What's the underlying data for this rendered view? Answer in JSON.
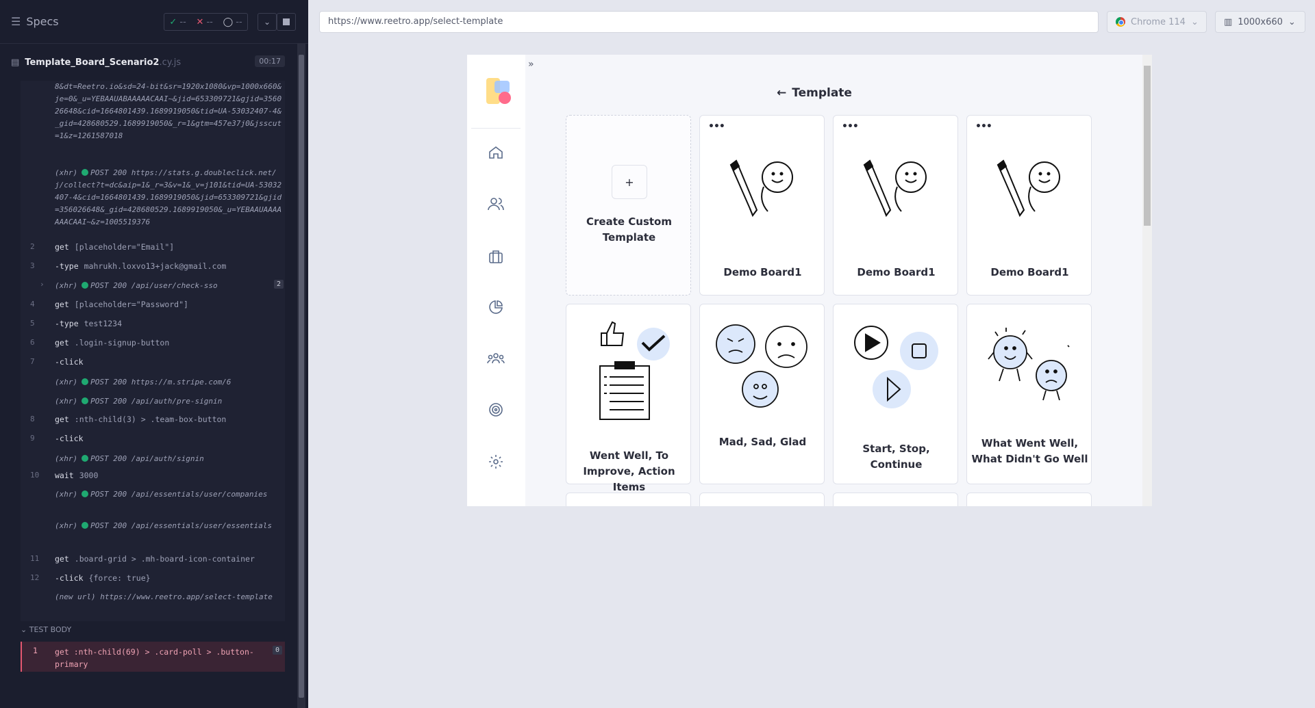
{
  "reporter": {
    "title": "Specs",
    "stats": {
      "passed": "--",
      "failed": "--",
      "pending": "--"
    },
    "spec_file": "Template_Board_Scenario2",
    "spec_ext": ".cy.js",
    "duration": "00:17",
    "log_top_text": "8&dt=Reetro.io&sd=24-bit&sr=1920x1080&vp=1000x660&je=0&_u=YEBAAUABAAAAACAAI~&jid=653309721&gjid=356026648&cid=1664801439.1689919050&tid=UA-53032407-4&_gid=428680529.1689919050&_r=1&gtm=457e37j0&jsscut=1&z=1261587018",
    "entries": [
      {
        "type": "xhr",
        "label": "(xhr)",
        "status": "POST 200",
        "url": "https://stats.g.doubleclick.net/j/collect?t=dc&aip=1&_r=3&v=1&_v=j101&tid=UA-53032407-4&cid=1664801439.1689919050&jid=653309721&gjid=356026648&_gid=428680529.1689919050&_u=YEBAAUAAAAAAACAAI~&z=1005519376"
      },
      {
        "type": "cmd",
        "num": "2",
        "name": "get",
        "arg": "[placeholder=\"Email\"]"
      },
      {
        "type": "cmd",
        "num": "3",
        "name": "-type",
        "arg": "mahrukh.loxvo13+jack@gmail.com"
      },
      {
        "type": "xhr",
        "label": "(xhr)",
        "status": "POST 200",
        "url": "/api/user/check-sso",
        "badge": "2"
      },
      {
        "type": "cmd",
        "num": "4",
        "name": "get",
        "arg": "[placeholder=\"Password\"]"
      },
      {
        "type": "cmd",
        "num": "5",
        "name": "-type",
        "arg": "test1234"
      },
      {
        "type": "cmd",
        "num": "6",
        "name": "get",
        "arg": ".login-signup-button"
      },
      {
        "type": "cmd",
        "num": "7",
        "name": "-click",
        "arg": ""
      },
      {
        "type": "xhr",
        "label": "(xhr)",
        "status": "POST 200",
        "url": "https://m.stripe.com/6"
      },
      {
        "type": "xhr",
        "label": "(xhr)",
        "status": "POST 200",
        "url": "/api/auth/pre-signin"
      },
      {
        "type": "cmd",
        "num": "8",
        "name": "get",
        "arg": ":nth-child(3) > .team-box-button"
      },
      {
        "type": "cmd",
        "num": "9",
        "name": "-click",
        "arg": ""
      },
      {
        "type": "xhr",
        "label": "(xhr)",
        "status": "POST 200",
        "url": "/api/auth/signin"
      },
      {
        "type": "cmd",
        "num": "10",
        "name": "wait",
        "arg": "3000"
      },
      {
        "type": "xhr",
        "label": "(xhr)",
        "status": "POST 200",
        "url": "/api/essentials/user/companies"
      },
      {
        "type": "xhr",
        "label": "(xhr)",
        "status": "POST 200",
        "url": "/api/essentials/user/essentials"
      },
      {
        "type": "cmd",
        "num": "11",
        "name": "get",
        "arg": ".board-grid > .mh-board-icon-container"
      },
      {
        "type": "cmd",
        "num": "12",
        "name": "-click",
        "arg": "{force: true}"
      },
      {
        "type": "newurl",
        "label": "(new url)",
        "url": "https://www.reetro.app/select-template"
      }
    ],
    "test_body_label": "TEST BODY",
    "failing": {
      "num": "1",
      "name": "get",
      "arg": ":nth-child(69) > .card-poll > .button-primary",
      "badge": "0"
    }
  },
  "browser": {
    "url": "https://www.reetro.app/select-template",
    "name": "Chrome 114",
    "viewport": "1000x660"
  },
  "app": {
    "page_title": "Template",
    "cards": [
      {
        "label": "Create Custom Template",
        "kind": "create"
      },
      {
        "label": "Demo Board1",
        "kind": "demo"
      },
      {
        "label": "Demo Board1",
        "kind": "demo"
      },
      {
        "label": "Demo Board1",
        "kind": "demo"
      },
      {
        "label": "Went Well, To Improve, Action Items",
        "kind": "wentwell"
      },
      {
        "label": "Mad, Sad, Glad",
        "kind": "madsad"
      },
      {
        "label": "Start, Stop, Continue",
        "kind": "startstop"
      },
      {
        "label": "What Went Well, What Didn't Go Well",
        "kind": "whatwent"
      }
    ],
    "more_dots": "•••",
    "plus": "+"
  },
  "colors": {
    "pass": "#1fa971",
    "fail": "#e45770",
    "accent_bg": "#1b1e2e"
  }
}
